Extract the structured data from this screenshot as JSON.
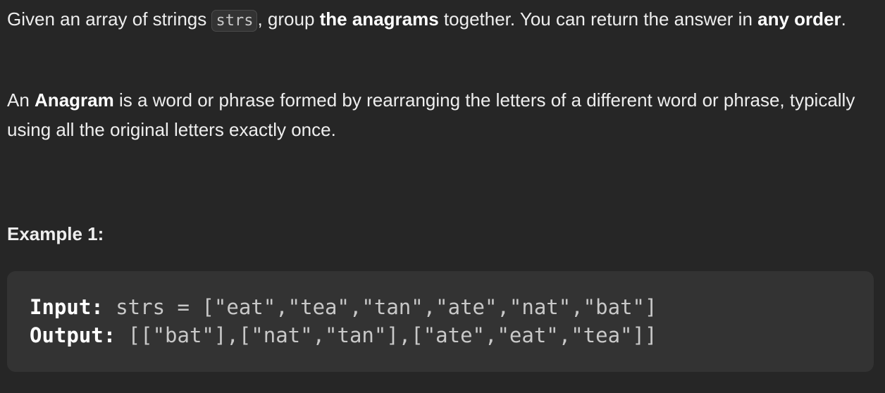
{
  "para1": {
    "t1": "Given an array of strings ",
    "code": "strs",
    "t2": ", group ",
    "b1": "the anagrams",
    "t3": " together. You can return the answer in ",
    "b2": "any order",
    "t4": "."
  },
  "para2": {
    "t1": "An ",
    "b1": "Anagram",
    "t2": " is a word or phrase formed by rearranging the letters of a different word or phrase, typically using all the original letters exactly once."
  },
  "example": {
    "title": "Example 1:",
    "input_label": "Input:",
    "input_value": " strs = [\"eat\",\"tea\",\"tan\",\"ate\",\"nat\",\"bat\"]",
    "output_label": "Output:",
    "output_value": " [[\"bat\"],[\"nat\",\"tan\"],[\"ate\",\"eat\",\"tea\"]]"
  }
}
